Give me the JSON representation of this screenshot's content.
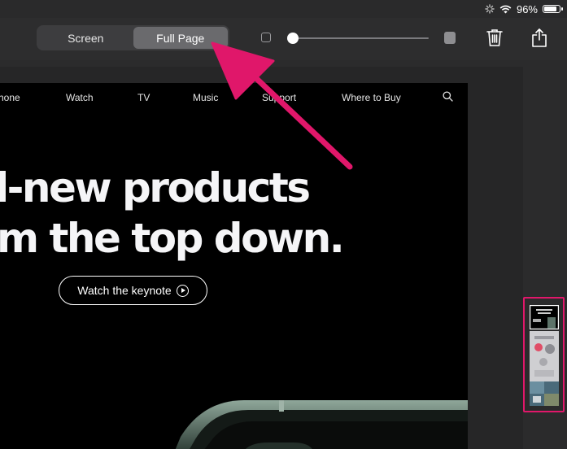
{
  "status": {
    "battery_percent": "96%",
    "battery_level": 0.96,
    "icons": [
      "loading-spinner-icon",
      "wifi-icon",
      "battery-icon"
    ]
  },
  "toolbar": {
    "segments": [
      {
        "label": "Screen",
        "selected": false
      },
      {
        "label": "Full Page",
        "selected": true
      }
    ],
    "zoom_slider_value": 0,
    "icons": [
      "small-square-icon",
      "large-square-icon",
      "trash-icon",
      "share-icon"
    ]
  },
  "webpage": {
    "nav": [
      "hone",
      "Watch",
      "TV",
      "Music",
      "Support",
      "Where to Buy"
    ],
    "nav_icon": "search-icon",
    "headline_line1": "l-new products",
    "headline_line2": "m the top down.",
    "button_label": "Watch the keynote",
    "button_icon": "play-circle-icon"
  },
  "annotations": {
    "arrow_color": "#e0176a",
    "highlight_color": "#e0176a"
  }
}
